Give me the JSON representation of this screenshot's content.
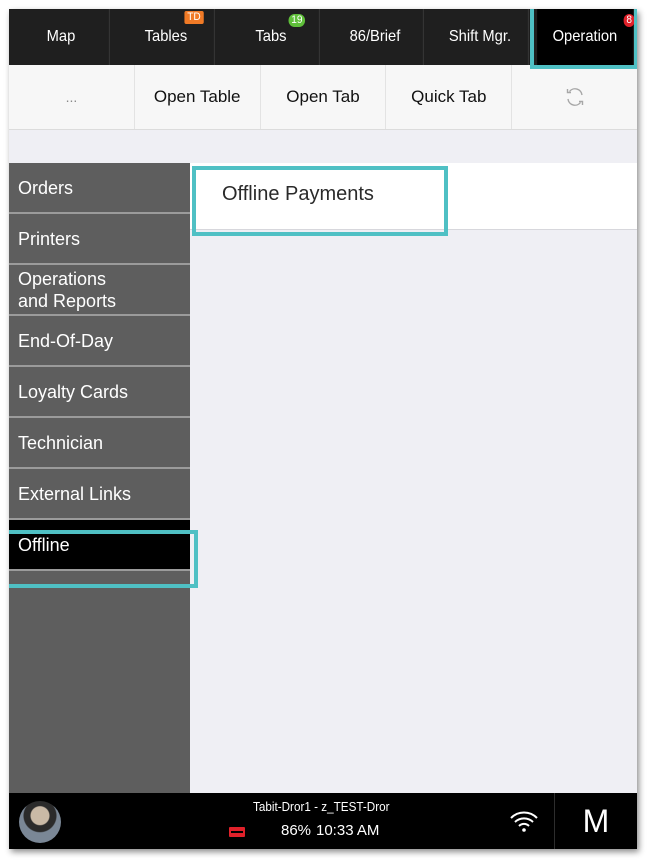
{
  "top_tabs": [
    {
      "label": "Map"
    },
    {
      "label": "Tables",
      "badge": "TD"
    },
    {
      "label": "Tabs",
      "badge": "19"
    },
    {
      "label": "86/Brief"
    },
    {
      "label": "Shift Mgr."
    },
    {
      "label": "Operation",
      "badge": "8"
    }
  ],
  "toolbar": {
    "more_label": "...",
    "open_table_label": "Open Table",
    "open_tab_label": "Open Tab",
    "quick_tab_label": "Quick Tab",
    "refresh_icon": "refresh-icon"
  },
  "sidebar": {
    "items": [
      {
        "label": "Orders"
      },
      {
        "label": "Printers"
      },
      {
        "label": "Operations and Reports"
      },
      {
        "label": "End-Of-Day"
      },
      {
        "label": "Loyalty Cards"
      },
      {
        "label": "Technician"
      },
      {
        "label": "External Links"
      },
      {
        "label": "Offline"
      }
    ],
    "active_index": 7
  },
  "content": {
    "items": [
      {
        "label": "Offline Payments"
      }
    ]
  },
  "status_bar": {
    "device_label": "Tabit-Dror1 - z_TEST-Dror",
    "battery_percent": "86%",
    "time": "10:33 AM",
    "user_initial": "M"
  },
  "colors": {
    "highlight": "#4fc0c4",
    "tab_badge_tables": "#f07a26",
    "tab_badge_tabs": "#5fbf3a",
    "tab_badge_operation": "#e0212a"
  }
}
